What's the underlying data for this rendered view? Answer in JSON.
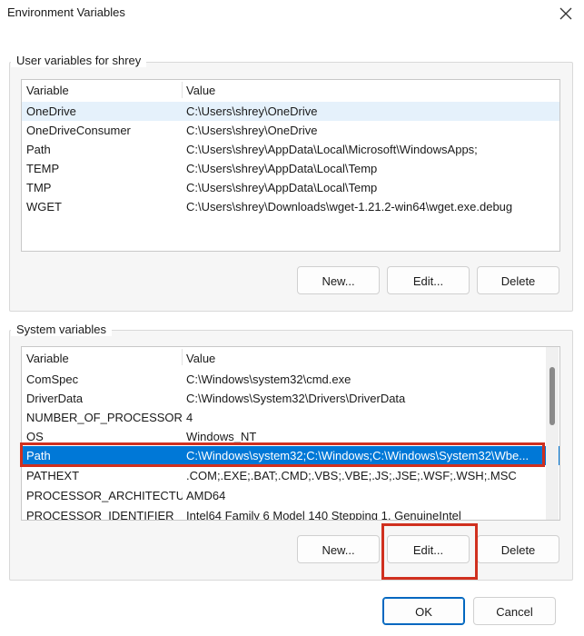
{
  "window": {
    "title": "Environment Variables",
    "close_icon": "close-icon"
  },
  "user_vars": {
    "group_label": "User variables for shrey",
    "headers": {
      "variable": "Variable",
      "value": "Value"
    },
    "rows": [
      {
        "variable": "OneDrive",
        "value": "C:\\Users\\shrey\\OneDrive"
      },
      {
        "variable": "OneDriveConsumer",
        "value": "C:\\Users\\shrey\\OneDrive"
      },
      {
        "variable": "Path",
        "value": "C:\\Users\\shrey\\AppData\\Local\\Microsoft\\WindowsApps;"
      },
      {
        "variable": "TEMP",
        "value": "C:\\Users\\shrey\\AppData\\Local\\Temp"
      },
      {
        "variable": "TMP",
        "value": "C:\\Users\\shrey\\AppData\\Local\\Temp"
      },
      {
        "variable": "WGET",
        "value": "C:\\Users\\shrey\\Downloads\\wget-1.21.2-win64\\wget.exe.debug"
      }
    ],
    "buttons": {
      "new": "New...",
      "edit": "Edit...",
      "delete": "Delete"
    }
  },
  "system_vars": {
    "group_label": "System variables",
    "headers": {
      "variable": "Variable",
      "value": "Value"
    },
    "rows": [
      {
        "variable": "ComSpec",
        "value": "C:\\Windows\\system32\\cmd.exe"
      },
      {
        "variable": "DriverData",
        "value": "C:\\Windows\\System32\\Drivers\\DriverData"
      },
      {
        "variable": "NUMBER_OF_PROCESSORS",
        "value": "4"
      },
      {
        "variable": "OS",
        "value": "Windows_NT"
      },
      {
        "variable": "Path",
        "value": "C:\\Windows\\system32;C:\\Windows;C:\\Windows\\System32\\Wbe..."
      },
      {
        "variable": "PATHEXT",
        "value": ".COM;.EXE;.BAT;.CMD;.VBS;.VBE;.JS;.JSE;.WSF;.WSH;.MSC"
      },
      {
        "variable": "PROCESSOR_ARCHITECTURE",
        "value": "AMD64"
      },
      {
        "variable": "PROCESSOR_IDENTIFIER",
        "value": "Intel64 Family 6 Model 140 Stepping 1, GenuineIntel"
      }
    ],
    "buttons": {
      "new": "New...",
      "edit": "Edit...",
      "delete": "Delete"
    }
  },
  "dialog_buttons": {
    "ok": "OK",
    "cancel": "Cancel"
  },
  "colors": {
    "selection": "#0078d7",
    "annotation_red": "#d0301f",
    "hover": "#e5f1fb"
  }
}
